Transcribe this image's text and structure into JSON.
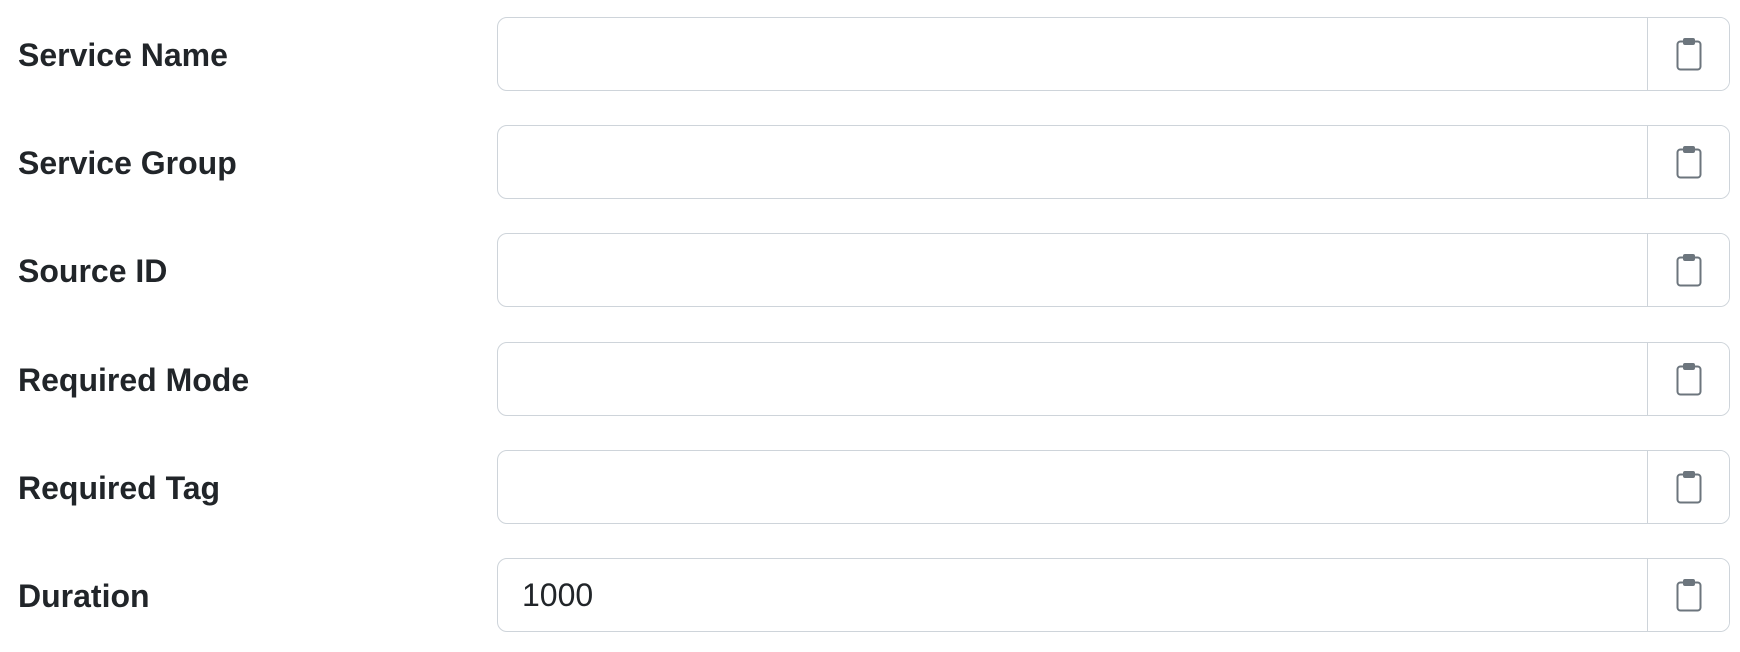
{
  "form": {
    "fields": [
      {
        "label": "Service Name",
        "value": "",
        "copy_icon": "clipboard-icon"
      },
      {
        "label": "Service Group",
        "value": "",
        "copy_icon": "clipboard-icon"
      },
      {
        "label": "Source ID",
        "value": "",
        "copy_icon": "clipboard-icon"
      },
      {
        "label": "Required Mode",
        "value": "",
        "copy_icon": "clipboard-icon"
      },
      {
        "label": "Required Tag",
        "value": "",
        "copy_icon": "clipboard-icon"
      },
      {
        "label": "Duration",
        "value": "1000",
        "copy_icon": "clipboard-icon"
      }
    ]
  },
  "colors": {
    "text": "#212529",
    "border": "#ced4da",
    "icon": "#6c757d"
  }
}
